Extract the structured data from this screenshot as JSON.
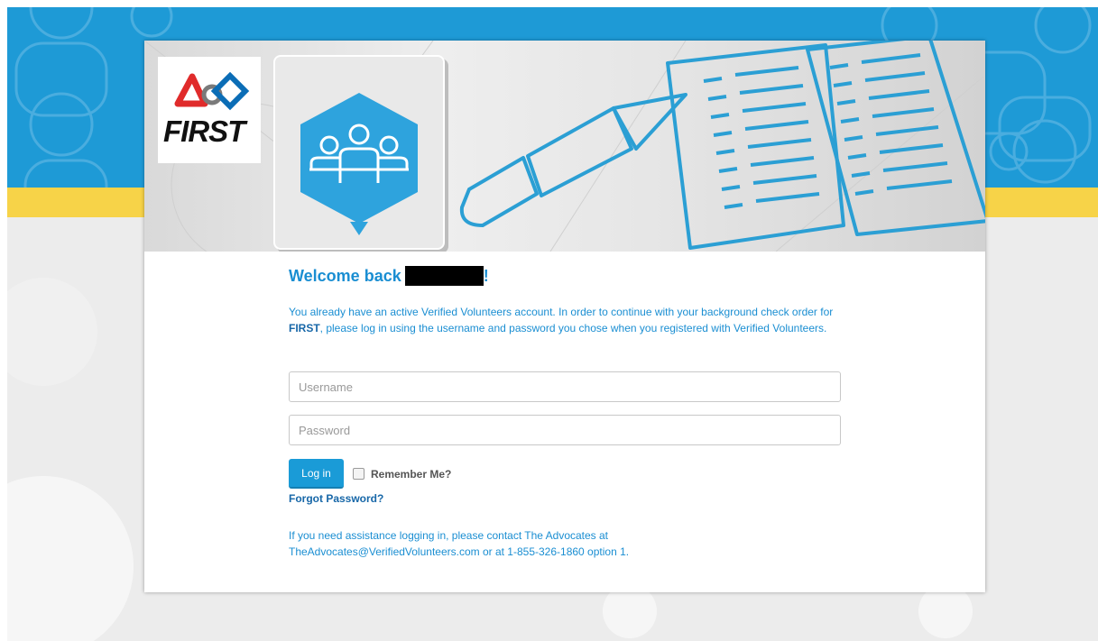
{
  "org": {
    "logo_text": "FIRST"
  },
  "welcome": {
    "prefix": "Welcome back",
    "suffix": "!"
  },
  "intro": {
    "part1": "You already have an active Verified Volunteers account. In order to continue with your background check order for ",
    "org_name": "FIRST",
    "part2": ", please log in using the username and password you chose when you registered with Verified Volunteers."
  },
  "form": {
    "username_placeholder": "Username",
    "username_value": "",
    "password_placeholder": "Password",
    "password_value": "",
    "login_label": "Log in",
    "remember_label": "Remember Me?",
    "remember_checked": false,
    "forgot_label": "Forgot Password?"
  },
  "assistance": {
    "line1": "If you need assistance logging in, please contact The Advocates at",
    "line2": "TheAdvocates@VerifiedVolunteers.com or at 1-855-326-1860 option 1."
  },
  "colors": {
    "accent_blue": "#1a8ed2",
    "band_blue": "#1e9ad6",
    "band_yellow": "#f7d348",
    "button_blue": "#1a9bd7",
    "logo_red": "#e02b2b",
    "logo_blue": "#0b6db6"
  },
  "icons": [
    "first-logo-icon",
    "volunteers-group-icon",
    "pencil-icon",
    "checklist-icon"
  ]
}
